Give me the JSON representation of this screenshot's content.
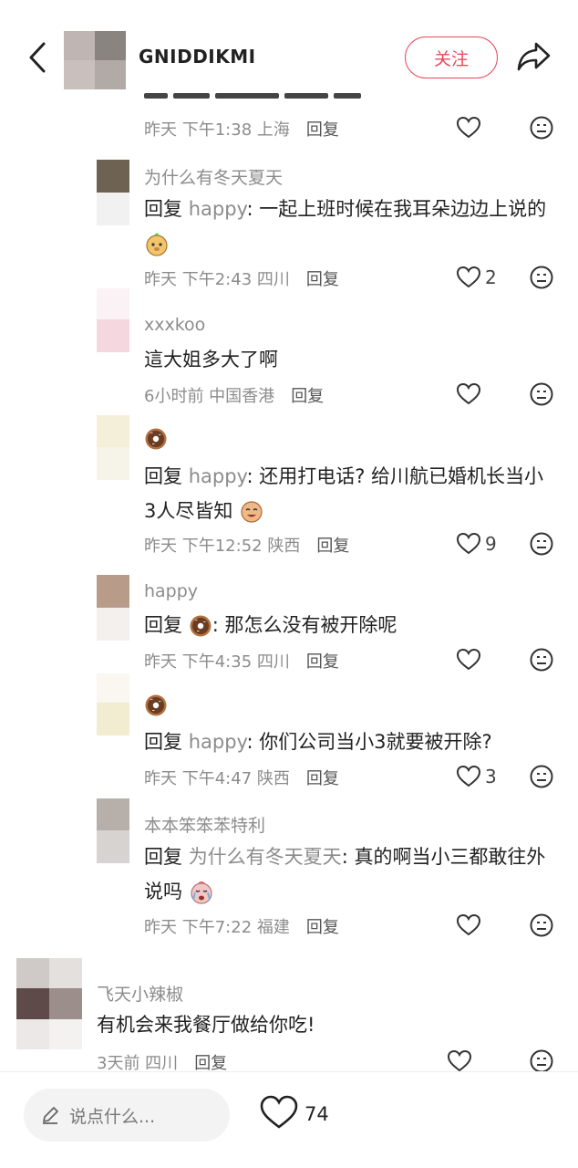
{
  "header": {
    "username": "GNIDDIKMI",
    "follow_label": "关注"
  },
  "comments": [
    {
      "meta_time": "昨天 下午1:38 上海",
      "reply_label": "回复",
      "likes": ""
    },
    {
      "name": "为什么有冬天夏天",
      "reply_prefix": "回复",
      "reply_to": "happy",
      "text": ": 一起上班时候在我耳朵边边上说的",
      "meta_time": "昨天 下午2:43 四川",
      "reply_label": "回复",
      "likes": "2"
    },
    {
      "name": "xxxkoo",
      "text": "這大姐多大了啊",
      "meta_time": "6小时前 中国香港",
      "reply_label": "回复",
      "likes": ""
    },
    {
      "name": "",
      "reply_prefix": "回复",
      "reply_to": "happy",
      "text": ": 还用打电话? 给川航已婚机长当小3人尽皆知",
      "meta_time": "昨天 下午12:52 陕西",
      "reply_label": "回复",
      "likes": "9"
    },
    {
      "name": "happy",
      "reply_prefix": "回复",
      "text": ": 那怎么没有被开除呢",
      "meta_time": "昨天 下午4:35 四川",
      "reply_label": "回复",
      "likes": ""
    },
    {
      "name": "",
      "reply_prefix": "回复",
      "reply_to": "happy",
      "text": ": 你们公司当小3就要被开除?",
      "meta_time": "昨天 下午4:47 陕西",
      "reply_label": "回复",
      "likes": "3"
    },
    {
      "name": "本本笨笨苯特利",
      "reply_prefix": "回复",
      "reply_to": "为什么有冬天夏天",
      "text": ": 真的啊当小三都敢往外说吗",
      "meta_time": "昨天 下午7:22 福建",
      "reply_label": "回复",
      "likes": ""
    },
    {
      "name": "飞天小辣椒",
      "text": "有机会来我餐厅做给你吃!",
      "meta_time": "3天前 四川",
      "reply_label": "回复",
      "likes": ""
    }
  ],
  "bottom": {
    "input_placeholder": "说点什么...",
    "like_count": "74"
  },
  "colors": {
    "accent": "#e8495c",
    "muted": "#8c8c8c",
    "text": "#222222"
  },
  "icons": [
    "back-arrow-icon",
    "share-icon",
    "heart-icon",
    "emoji-face-icon",
    "donut-emoji-icon",
    "pencil-icon"
  ]
}
